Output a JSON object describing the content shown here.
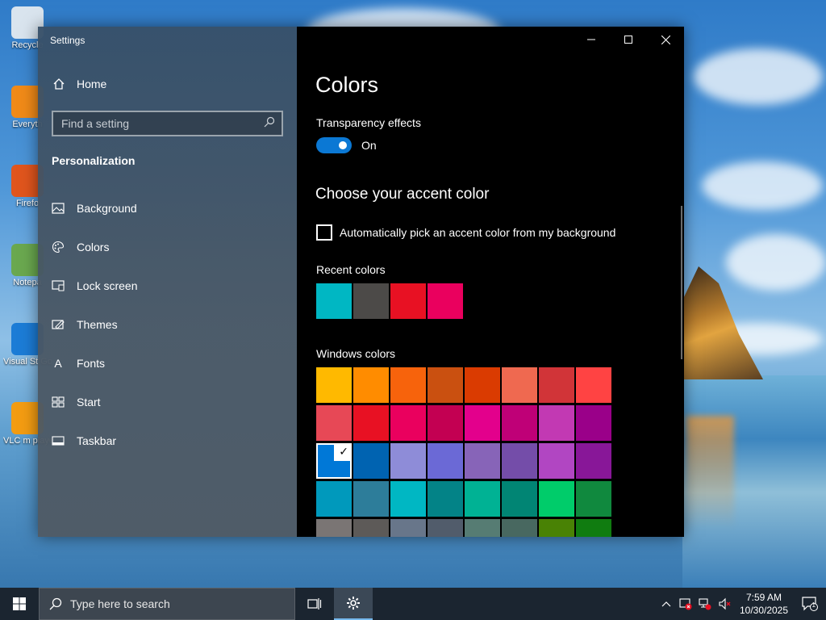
{
  "desktop": {
    "icons": [
      {
        "label": "Recycle",
        "color": "#d9e4ee"
      },
      {
        "label": "Everyth",
        "color": "#f08a18"
      },
      {
        "label": "Firefo",
        "color": "#e0551d"
      },
      {
        "label": "Notepa",
        "color": "#6aa84f"
      },
      {
        "label": "Visual St Godo",
        "color": "#1c7cd6"
      },
      {
        "label": "VLC m playe",
        "color": "#f39c12"
      }
    ]
  },
  "window": {
    "title": "Settings",
    "nav": {
      "home_label": "Home",
      "search_placeholder": "Find a setting",
      "section_title": "Personalization",
      "items": [
        {
          "label": "Background",
          "icon": "image-icon"
        },
        {
          "label": "Colors",
          "icon": "palette-icon"
        },
        {
          "label": "Lock screen",
          "icon": "lock-screen-icon"
        },
        {
          "label": "Themes",
          "icon": "themes-icon"
        },
        {
          "label": "Fonts",
          "icon": "fonts-icon"
        },
        {
          "label": "Start",
          "icon": "start-icon"
        },
        {
          "label": "Taskbar",
          "icon": "taskbar-icon"
        }
      ]
    },
    "content": {
      "title": "Colors",
      "transparency_label": "Transparency effects",
      "transparency_state": "On",
      "accent_heading": "Choose your accent color",
      "auto_pick_label": "Automatically pick an accent color from my background",
      "recent_label": "Recent colors",
      "recent_colors": [
        "#00b7c3",
        "#4c4a48",
        "#e81123",
        "#ea005e"
      ],
      "windows_label": "Windows colors",
      "windows_colors": [
        "#ffb900",
        "#ff8c00",
        "#f7630c",
        "#ca5010",
        "#da3b01",
        "#ef6950",
        "#d13438",
        "#ff4343",
        "#e74856",
        "#e81123",
        "#ea005e",
        "#c30052",
        "#e3008c",
        "#bf0077",
        "#c239b3",
        "#9a0089",
        "#0078d7",
        "#0063b1",
        "#8e8cd8",
        "#6b69d6",
        "#8764b8",
        "#744da9",
        "#b146c2",
        "#881798",
        "#0099bc",
        "#2d7d9a",
        "#00b7c3",
        "#038387",
        "#00b294",
        "#018574",
        "#00cc6a",
        "#10893e",
        "#7a7574",
        "#5d5a58",
        "#68768a",
        "#515c6b",
        "#567c73",
        "#486860",
        "#498205",
        "#107c10"
      ],
      "selected_index": 16
    }
  },
  "taskbar": {
    "search_placeholder": "Type here to search",
    "time": "7:59 AM",
    "date": "10/30/2025",
    "notification_count": "1"
  }
}
